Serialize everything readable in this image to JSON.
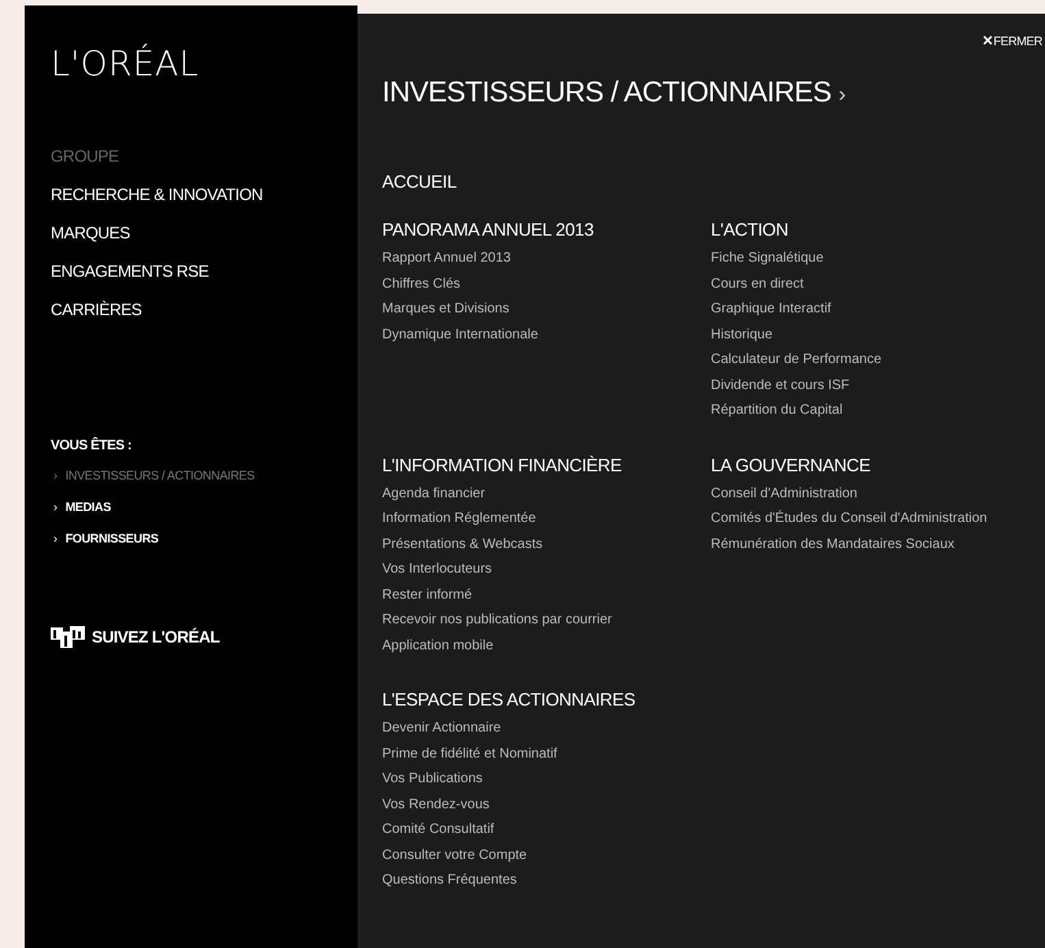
{
  "sidebar": {
    "logo": "L'ORÉAL",
    "nav": [
      {
        "label": "GROUPE",
        "selected": true
      },
      {
        "label": "RECHERCHE & INNOVATION",
        "selected": false
      },
      {
        "label": "MARQUES",
        "selected": false
      },
      {
        "label": "ENGAGEMENTS RSE",
        "selected": false
      },
      {
        "label": "CARRIÈRES",
        "selected": false
      }
    ],
    "audience_title": "VOUS ÊTES :",
    "audience": [
      {
        "marker": "›",
        "label": "INVESTISSEURS / ACTIONNAIRES",
        "selected": true
      },
      {
        "marker": "›",
        "label": "MEDIAS",
        "selected": false
      },
      {
        "marker": "›",
        "label": "FOURNISSEURS",
        "selected": false
      }
    ],
    "follow": "SUIVEZ L'ORÉAL"
  },
  "panel": {
    "close": {
      "icon": "✕",
      "label": "FERMER"
    },
    "title": "INVESTISSEURS / ACTIONNAIRES",
    "title_marker": "›",
    "home": "ACCUEIL",
    "sections": [
      {
        "title": "PANORAMA ANNUEL 2013",
        "links": [
          "Rapport Annuel 2013",
          "Chiffres Clés",
          "Marques et Divisions",
          "Dynamique Internationale"
        ]
      },
      {
        "title": "L'ACTION",
        "links": [
          "Fiche Signalétique",
          "Cours en direct",
          "Graphique Interactif",
          "Historique",
          "Calculateur de Performance",
          "Dividende et cours ISF",
          "Répartition du Capital"
        ]
      },
      {
        "title": "L'INFORMATION FINANCIÈRE",
        "links": [
          "Agenda financier",
          "Information Réglementée",
          "Présentations & Webcasts",
          "Vos Interlocuteurs",
          "Rester informé",
          "Recevoir nos publications par courrier",
          "Application mobile"
        ]
      },
      {
        "title": "LA GOUVERNANCE",
        "links": [
          "Conseil d'Administration",
          "Comités d'Études du Conseil d'Administration",
          "Rémunération des Mandataires Sociaux"
        ]
      },
      {
        "title": "L'ESPACE DES ACTIONNAIRES",
        "links": [
          "Devenir Actionnaire",
          "Prime de fidélité et Nominatif",
          "Vos Publications",
          "Vos Rendez-vous",
          "Comité Consultatif",
          "Consulter votre Compte",
          "Questions Fréquentes"
        ]
      }
    ]
  }
}
